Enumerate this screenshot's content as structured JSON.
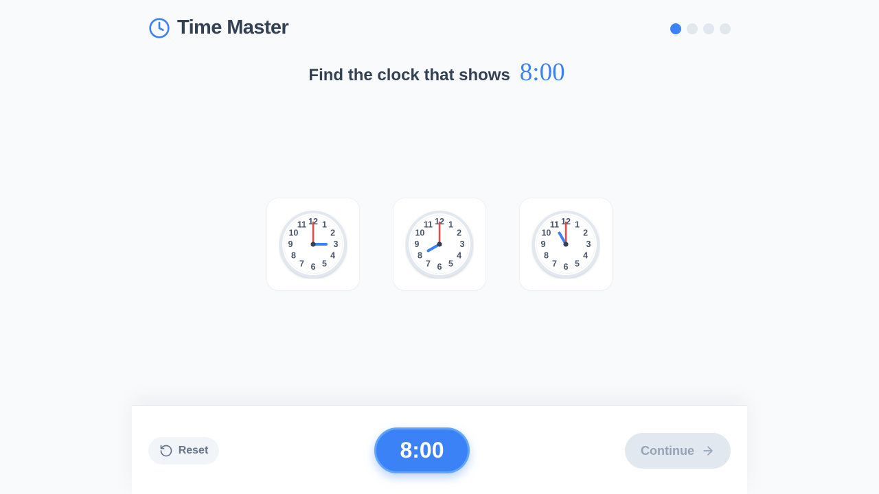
{
  "header": {
    "title": "Time Master",
    "icon": "clock-icon",
    "progress": {
      "total": 4,
      "current": 1
    }
  },
  "prompt": {
    "text": "Find the clock that shows",
    "target_time": "8:00"
  },
  "options": [
    {
      "id": "clock-1",
      "hour": 3,
      "minute": 0
    },
    {
      "id": "clock-2",
      "hour": 8,
      "minute": 0
    },
    {
      "id": "clock-3",
      "hour": 11,
      "minute": 0
    }
  ],
  "clock_numbers": [
    "1",
    "2",
    "3",
    "4",
    "5",
    "6",
    "7",
    "8",
    "9",
    "10",
    "11",
    "12"
  ],
  "footer": {
    "reset_label": "Reset",
    "reset_icon": "rotate-ccw-icon",
    "time_display": "8:00",
    "continue_label": "Continue",
    "continue_icon": "arrow-right-icon",
    "continue_enabled": false
  },
  "colors": {
    "accent": "#3b82f6",
    "minute_hand": "#ef4444",
    "hour_hand": "#3b82f6",
    "text": "#334155",
    "muted": "#94a3b8"
  }
}
